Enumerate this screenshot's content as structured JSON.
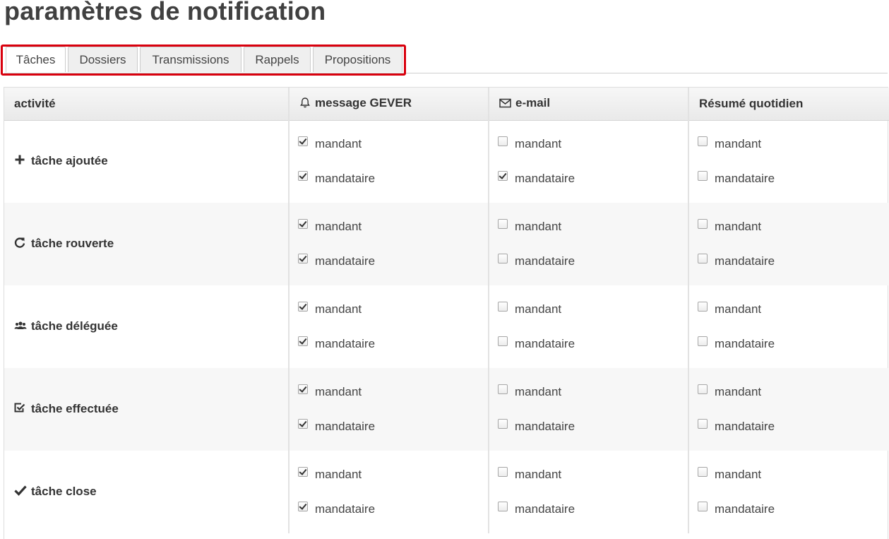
{
  "page": {
    "title": "paramètres de notification"
  },
  "tabs": [
    {
      "label": "Tâches",
      "active": true
    },
    {
      "label": "Dossiers",
      "active": false
    },
    {
      "label": "Transmissions",
      "active": false
    },
    {
      "label": "Rappels",
      "active": false
    },
    {
      "label": "Propositions",
      "active": false
    }
  ],
  "table": {
    "headers": {
      "activity": "activité",
      "gever": "message GEVER",
      "email": "e-mail",
      "digest": "Résumé quotidien"
    },
    "header_icons": {
      "gever": "bell-icon",
      "email": "envelope-icon"
    },
    "role_labels": {
      "issuer": "mandant",
      "responsible": "mandataire"
    },
    "rows": [
      {
        "label": "tâche ajoutée",
        "icon": "plus-icon",
        "gever": [
          true,
          true
        ],
        "email": [
          false,
          true
        ],
        "digest": [
          false,
          false
        ]
      },
      {
        "label": "tâche rouverte",
        "icon": "refresh-icon",
        "gever": [
          true,
          true
        ],
        "email": [
          false,
          false
        ],
        "digest": [
          false,
          false
        ]
      },
      {
        "label": "tâche déléguée",
        "icon": "users-icon",
        "gever": [
          true,
          true
        ],
        "email": [
          false,
          false
        ],
        "digest": [
          false,
          false
        ]
      },
      {
        "label": "tâche effectuée",
        "icon": "check-square-icon",
        "gever": [
          true,
          true
        ],
        "email": [
          false,
          false
        ],
        "digest": [
          false,
          false
        ]
      },
      {
        "label": "tâche close",
        "icon": "check-icon",
        "gever": [
          true,
          true
        ],
        "email": [
          false,
          false
        ],
        "digest": [
          false,
          false
        ]
      }
    ]
  },
  "colors": {
    "highlight": "#d9000d",
    "row_alt": "#f7f7f7"
  }
}
